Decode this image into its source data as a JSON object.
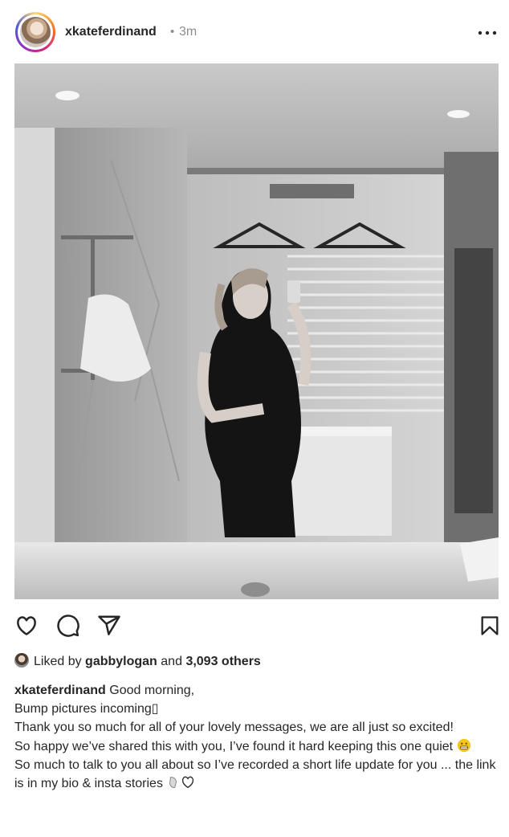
{
  "post": {
    "username": "xkateferdinand",
    "separator": "•",
    "time": "3m",
    "more_icon": "more-options-icon"
  },
  "image": {
    "description_icon": "photo"
  },
  "actions": {
    "icons": [
      "heart-icon",
      "comment-icon",
      "share-icon",
      "bookmark-icon"
    ]
  },
  "likes": {
    "prefix": "Liked by",
    "user": "gabbylogan",
    "conjunction": "and",
    "others": "3,093 others"
  },
  "caption": {
    "username": "xkateferdinand",
    "line1": "Good morning,",
    "line2": "Bump pictures incoming▯",
    "line3": "Thank you so much for all of your lovely messages, we are all just so excited!",
    "line4": "So happy we’ve shared this with you, I’ve found it hard keeping this one quiet",
    "line5": "So much to talk to you all about so I’ve recorded a short life update for you ... the link is in my bio & insta stories"
  },
  "colors": {
    "text": "#262626",
    "muted": "#8e8e8e",
    "background": "#ffffff"
  }
}
